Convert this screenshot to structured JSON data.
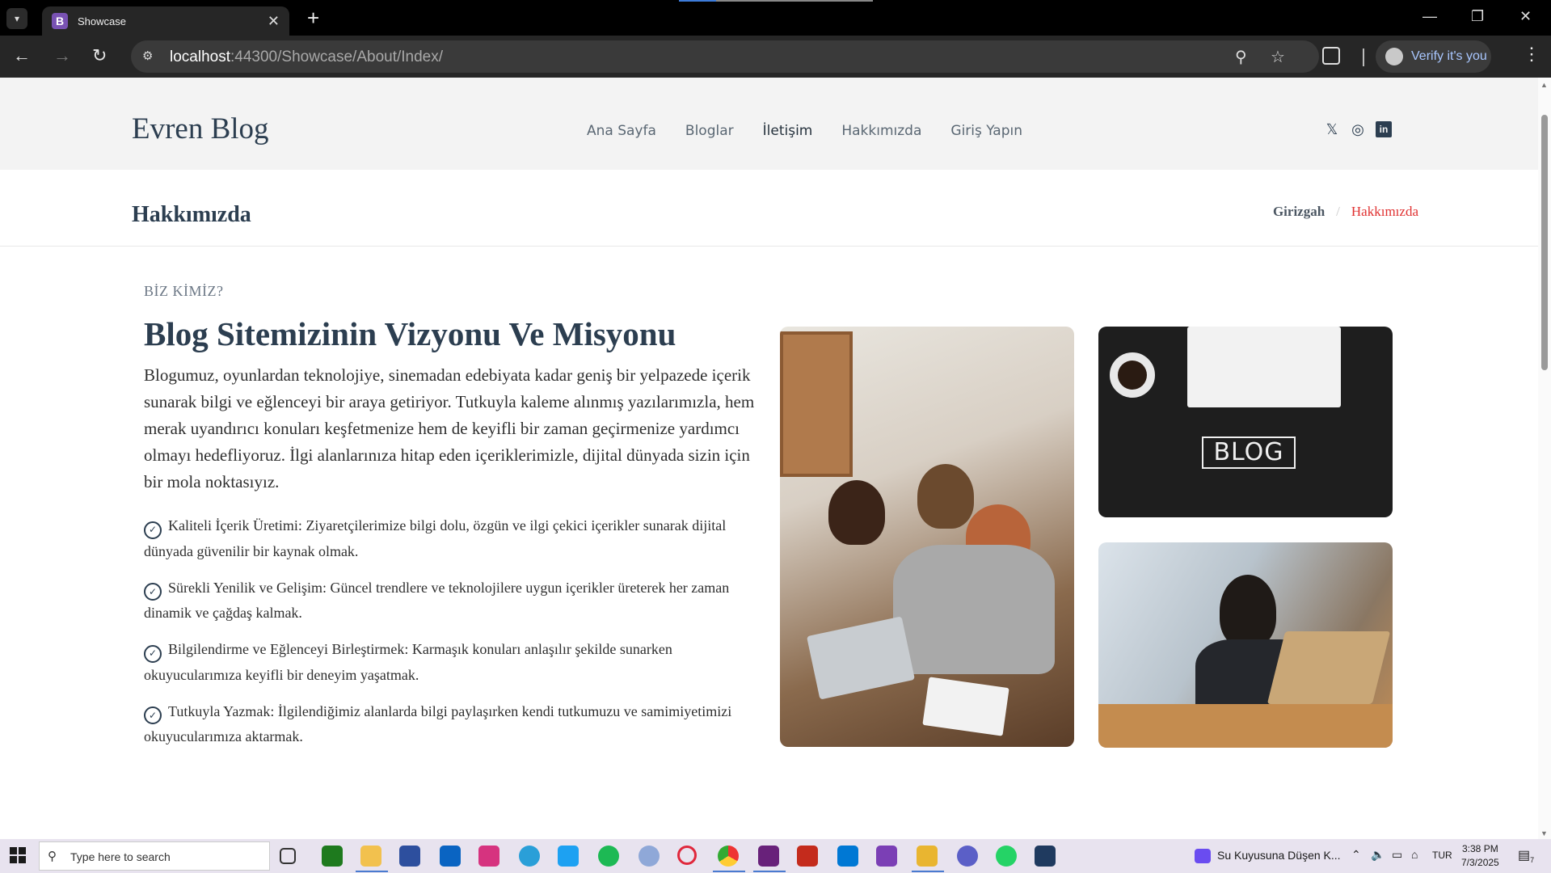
{
  "browser": {
    "tab_title": "Showcase",
    "tab_favicon_letter": "B",
    "url_host": "localhost",
    "url_rest": ":44300/Showcase/About/Index/",
    "profile_label": "Verify it's you"
  },
  "site": {
    "logo": "Evren Blog",
    "nav": [
      "Ana Sayfa",
      "Bloglar",
      "İletişim",
      "Hakkımızda",
      "Giriş Yapın"
    ],
    "socials": [
      "x-icon",
      "instagram-icon",
      "linkedin-icon"
    ]
  },
  "page_header": {
    "title": "Hakkımızda",
    "breadcrumb_home": "Girizgah",
    "breadcrumb_sep": "/",
    "breadcrumb_current": "Hakkımızda"
  },
  "about": {
    "eyebrow": "BİZ KİMİZ?",
    "title": "Blog Sitemizinin Vizyonu Ve Misyonu",
    "lead": "Blogumuz, oyunlardan teknolojiye, sinemadan edebiyata kadar geniş bir yelpazede içerik sunarak bilgi ve eğlenceyi bir araya getiriyor. Tutkuyla kaleme alınmış yazılarımızla, hem merak uyandırıcı konuları keşfetmenize hem de keyifli bir zaman geçirmenize yardımcı olmayı hedefliyoruz. İlgi alanlarınıza hitap eden içeriklerimizle, dijital dünyada sizin için bir mola noktasıyız.",
    "features": [
      "Kaliteli İçerik Üretimi: Ziyaretçilerimize bilgi dolu, özgün ve ilgi çekici içerikler sunarak dijital dünyada güvenilir bir kaynak olmak.",
      "Sürekli Yenilik ve Gelişim: Güncel trendlere ve teknolojilere uygun içerikler üreterek her zaman dinamik ve çağdaş kalmak.",
      "Bilgilendirme ve Eğlenceyi Birleştirmek: Karmaşık konuları anlaşılır şekilde sunarken okuyucularımıza keyifli bir deneyim yaşatmak.",
      "Tutkuyla Yazmak: İlgilendiğimiz alanlarda bilgi paylaşırken kendi tutkumuzu ve samimiyetimizi okuyucularımıza aktarmak."
    ],
    "blog_image_text": "BLOG"
  },
  "taskbar": {
    "search_placeholder": "Type here to search",
    "media_title": "Su Kuyusuna Düşen K...",
    "lang": "TUR",
    "time": "3:38 PM",
    "date": "7/3/2025",
    "notif_count": "7"
  },
  "colors": {
    "accent_red": "#e03131",
    "heading": "#2c3e50",
    "header_bg": "#f3f3f3"
  }
}
